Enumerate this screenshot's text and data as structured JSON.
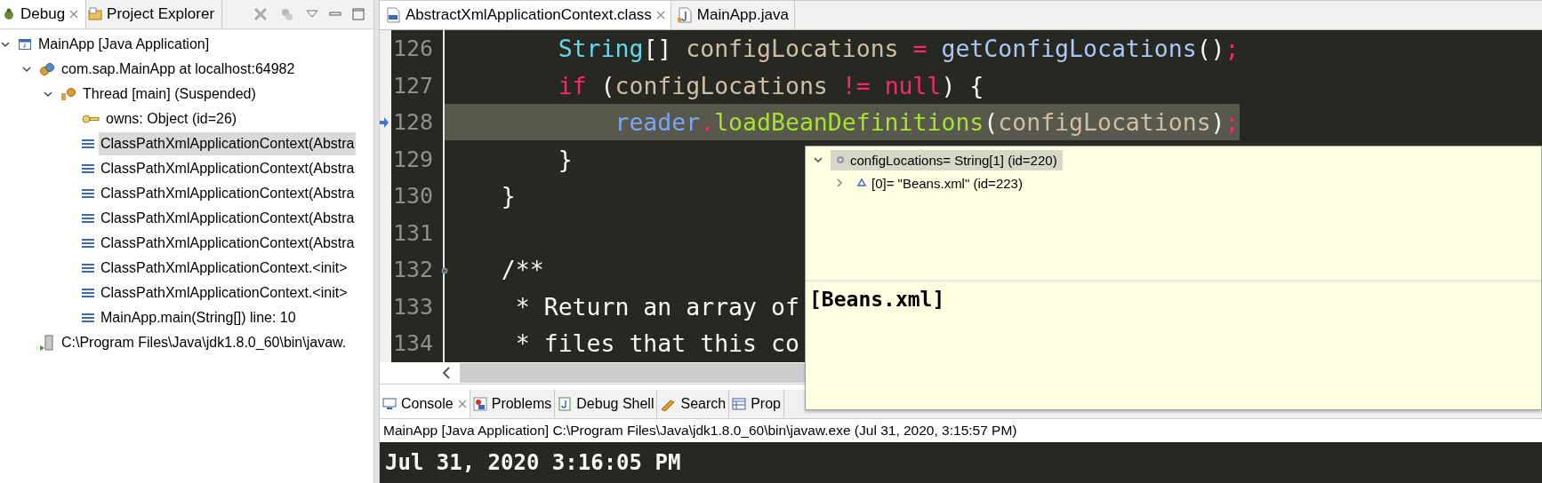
{
  "debug_view": {
    "tabs": [
      {
        "label": "Debug",
        "selected": true
      },
      {
        "label": "Project Explorer",
        "selected": false
      }
    ],
    "tree": [
      {
        "kind": "launch",
        "label": "MainApp [Java Application]",
        "expanded": true,
        "selected": false,
        "children": [
          {
            "kind": "target",
            "label": "com.sap.MainApp at localhost:64982",
            "expanded": true,
            "selected": false,
            "children": [
              {
                "kind": "thread",
                "label": "Thread [main] (Suspended)",
                "expanded": true,
                "selected": false,
                "children": [
                  {
                    "kind": "monitor",
                    "label": "owns: Object  (id=26)",
                    "selected": false
                  },
                  {
                    "kind": "frame",
                    "label": "ClassPathXmlApplicationContext(Abstra",
                    "selected": true
                  },
                  {
                    "kind": "frame",
                    "label": "ClassPathXmlApplicationContext(Abstra",
                    "selected": false
                  },
                  {
                    "kind": "frame",
                    "label": "ClassPathXmlApplicationContext(Abstra",
                    "selected": false
                  },
                  {
                    "kind": "frame",
                    "label": "ClassPathXmlApplicationContext(Abstra",
                    "selected": false
                  },
                  {
                    "kind": "frame",
                    "label": "ClassPathXmlApplicationContext(Abstra",
                    "selected": false
                  },
                  {
                    "kind": "frame",
                    "label": "ClassPathXmlApplicationContext.<init>",
                    "selected": false
                  },
                  {
                    "kind": "frame",
                    "label": "ClassPathXmlApplicationContext.<init>",
                    "selected": false
                  },
                  {
                    "kind": "frame",
                    "label": "MainApp.main(String[]) line: 10",
                    "selected": false
                  }
                ]
              }
            ]
          },
          {
            "kind": "process",
            "label": "C:\\Program Files\\Java\\jdk1.8.0_60\\bin\\javaw.",
            "selected": false
          }
        ]
      }
    ]
  },
  "editor": {
    "tabs": [
      {
        "label": "AbstractXmlApplicationContext.class",
        "selected": true,
        "kind": "class"
      },
      {
        "label": "MainApp.java",
        "selected": false,
        "kind": "java"
      }
    ],
    "lines": [
      {
        "number": "126",
        "current": false,
        "fold_marker": false,
        "tokens": [
          {
            "kind": "type",
            "text": "        String"
          },
          {
            "kind": "punct",
            "text": "[] "
          },
          {
            "kind": "ident",
            "text": "configLocations "
          },
          {
            "kind": "op",
            "text": "= "
          },
          {
            "kind": "method",
            "text": "getConfigLocations"
          },
          {
            "kind": "punct",
            "text": "()"
          },
          {
            "kind": "op",
            "text": ";"
          }
        ]
      },
      {
        "number": "127",
        "current": false,
        "fold_marker": false,
        "tokens": [
          {
            "kind": "keyword",
            "text": "        if "
          },
          {
            "kind": "punct",
            "text": "("
          },
          {
            "kind": "ident",
            "text": "configLocations "
          },
          {
            "kind": "op",
            "text": "!= "
          },
          {
            "kind": "keyword",
            "text": "null"
          },
          {
            "kind": "punct",
            "text": ") {"
          }
        ]
      },
      {
        "number": "128",
        "current": true,
        "fold_marker": false,
        "tokens": [
          {
            "kind": "field",
            "text": "            reader"
          },
          {
            "kind": "op",
            "text": "."
          },
          {
            "kind": "call",
            "text": "loadBeanDefinitions"
          },
          {
            "kind": "punct",
            "text": "("
          },
          {
            "kind": "ident",
            "text": "configLocations"
          },
          {
            "kind": "punct",
            "text": ")"
          },
          {
            "kind": "op",
            "text": ";"
          }
        ]
      },
      {
        "number": "129",
        "current": false,
        "fold_marker": false,
        "tokens": [
          {
            "kind": "punct",
            "text": "        }"
          }
        ]
      },
      {
        "number": "130",
        "current": false,
        "fold_marker": false,
        "tokens": [
          {
            "kind": "punct",
            "text": "    }"
          }
        ]
      },
      {
        "number": "131",
        "current": false,
        "fold_marker": false
      },
      {
        "number": "132",
        "current": false,
        "fold_marker": true,
        "tokens": [
          {
            "kind": "comment",
            "text": "    /**"
          }
        ]
      },
      {
        "number": "133",
        "current": false,
        "fold_marker": false,
        "tokens": [
          {
            "kind": "comment",
            "text": "     * Return an array of"
          }
        ]
      },
      {
        "number": "134",
        "current": false,
        "fold_marker": false,
        "tokens": [
          {
            "kind": "comment",
            "text": "     * files that this co"
          }
        ]
      }
    ]
  },
  "bottom_panel": {
    "tabs": [
      {
        "label": "Console",
        "selected": true,
        "kind": "console"
      },
      {
        "label": "Problems",
        "selected": false,
        "kind": "problems"
      },
      {
        "label": "Debug Shell",
        "selected": false,
        "kind": "shell"
      },
      {
        "label": "Search",
        "selected": false,
        "kind": "search"
      },
      {
        "label": "Prop",
        "selected": false,
        "kind": "properties"
      }
    ],
    "console_title": "MainApp [Java Application] C:\\Program Files\\Java\\jdk1.8.0_60\\bin\\javaw.exe (Jul 31, 2020, 3:15:57 PM)",
    "console_output": "Jul 31, 2020 3:16:05 PM"
  },
  "hover_popup": {
    "tree": [
      {
        "label": "configLocations= String[1]  (id=220)",
        "kind": "local",
        "expanded": true,
        "selected": true,
        "children": [
          {
            "label": "[0]= \"Beans.xml\" (id=223)",
            "kind": "element",
            "expanded": false,
            "selected": false
          }
        ]
      }
    ],
    "detail": "[Beans.xml]"
  }
}
